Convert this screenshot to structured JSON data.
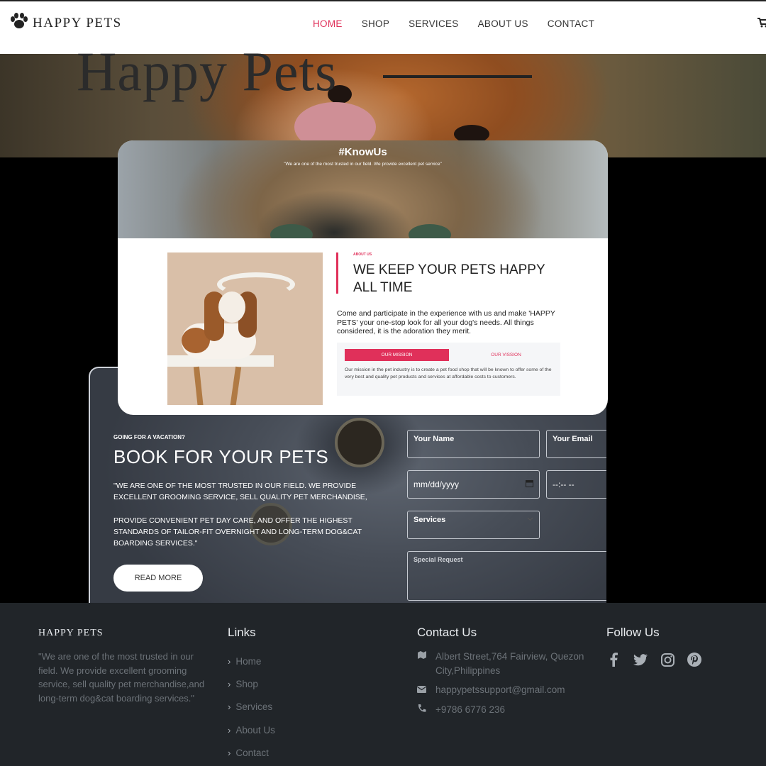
{
  "nav": {
    "brand": "HAPPY PETS",
    "links": [
      "HOME",
      "SHOP",
      "SERVICES",
      "ABOUT US",
      "CONTACT"
    ],
    "active": "HOME",
    "accent_color": "#e0305a"
  },
  "hero": {
    "title": "Happy Pets"
  },
  "about": {
    "banner_tag": "#KnowUs",
    "banner_quote": "\"We are one of the most trusted in our field. We provide excellent pet service\"",
    "overline": "ABOUT US",
    "title": "WE KEEP YOUR PETS HAPPY ALL TIME",
    "text": "Come and participate in the experience with us and make 'HAPPY PETS' your one-stop look for all your dog's needs. All things considered, it is the adoration they merit.",
    "tabs": [
      "OUR MISSION",
      "OUR VISSION"
    ],
    "tab_text": "Our mission in the pet industry is to create a pet food shop that will be known to offer some of the very best and quality pet products and services at affordable costs to customers."
  },
  "booking": {
    "overline": "GOING FOR A VACATION?",
    "title": "BOOK FOR YOUR PETS",
    "para1": "\"WE ARE ONE OF THE MOST TRUSTED IN OUR FIELD. WE PROVIDE EXCELLENT GROOMING SERVICE, SELL QUALITY PET MERCHANDISE,",
    "para2": "PROVIDE CONVENIENT PET DAY CARE, AND OFFER THE HIGHEST STANDARDS OF TAILOR-FIT OVERNIGHT AND LONG-TERM DOG&CAT BOARDING SERVICES.\"",
    "button": "READ MORE",
    "fields": {
      "name": "Your Name",
      "email": "Your Email",
      "date": "mm/dd/yyyy",
      "time": "--:-- --",
      "services": "Services",
      "request": "Special Request"
    }
  },
  "footer": {
    "brand": "HAPPY PETS",
    "description": "\"We are one of the most trusted in our field. We provide excellent grooming service, sell quality pet merchandise,and long-term dog&cat boarding services.\"",
    "links_heading": "Links",
    "links": [
      "Home",
      "Shop",
      "Services",
      "About Us",
      "Contact"
    ],
    "contact_heading": "Contact Us",
    "address": "Albert Street,764 Fairview, Quezon City,Philippines",
    "email": "happypetssupport@gmail.com",
    "phone": "+9786 6776 236",
    "follow_heading": "Follow Us",
    "socials": [
      "facebook-icon",
      "twitter-icon",
      "instagram-icon",
      "pinterest-icon"
    ]
  }
}
